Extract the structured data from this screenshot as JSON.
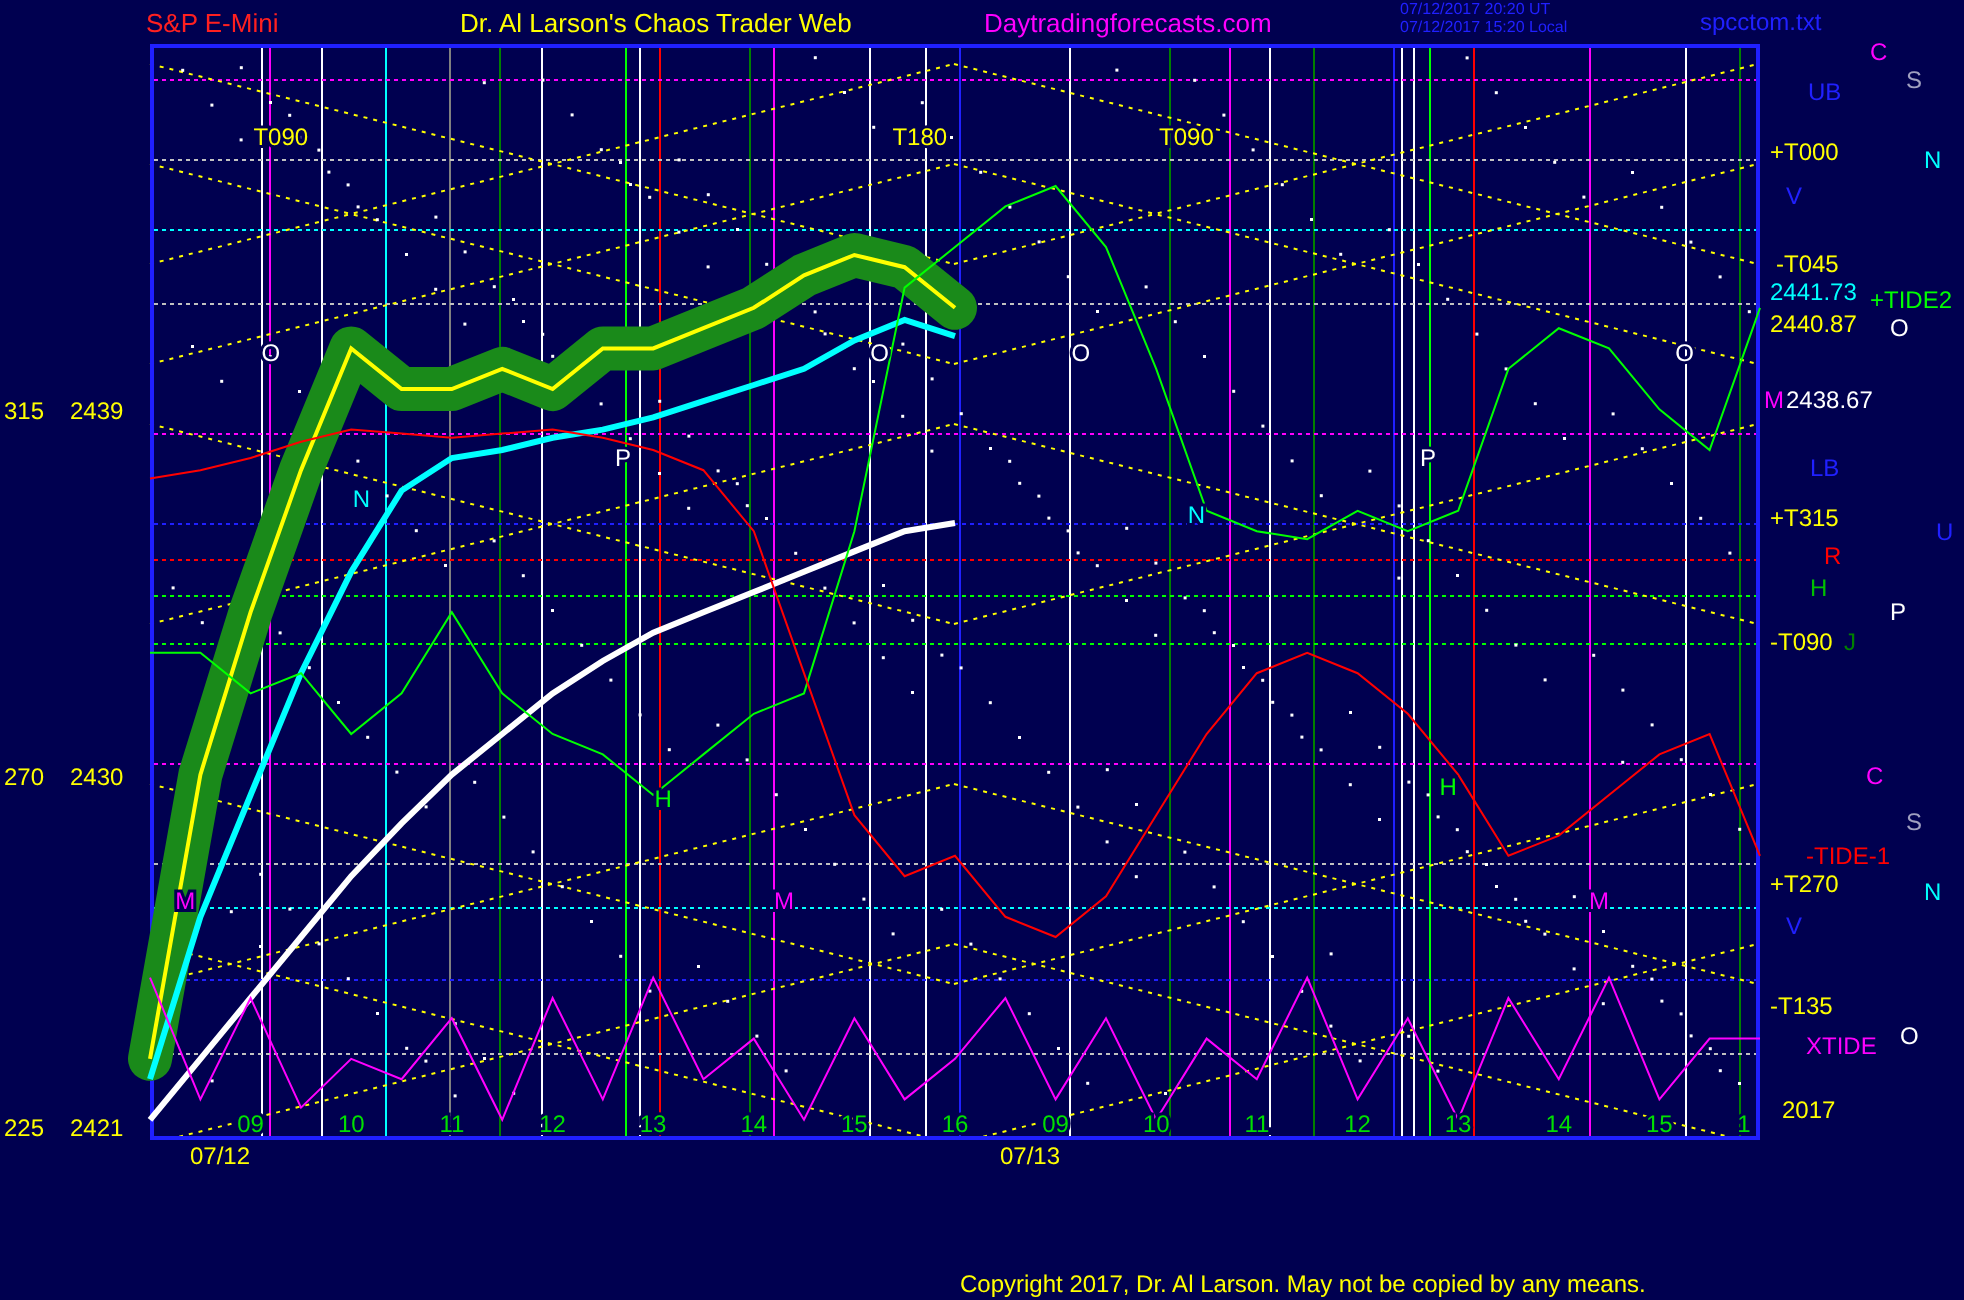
{
  "header": {
    "symbol": "S&P E-Mini",
    "title": "Dr. Al Larson's Chaos Trader Web",
    "site": "Daytradingforecasts.com",
    "timestamps": [
      "07/12/2017 20:20 UT",
      "07/12/2017 15:20 Local"
    ],
    "file": "spcctom.txt"
  },
  "chart": {
    "chart_data": {
      "type": "line",
      "categories": [
        null,
        null,
        "09",
        null,
        "10",
        null,
        "11",
        null,
        "12",
        null,
        "13",
        null,
        "14",
        null,
        "15",
        null,
        "16",
        null,
        "09",
        null,
        "10",
        null,
        "11",
        null,
        "12",
        null,
        "13",
        null,
        "14",
        null,
        "15",
        null,
        "1"
      ],
      "ylim": [
        2421,
        2448
      ],
      "grid": true,
      "yticks": [
        2439,
        2430,
        2421
      ],
      "series": [
        {
          "color": "#ffff00",
          "values": [
            2423,
            2430,
            2434,
            2437.5,
            2440.5,
            2439.5,
            2439.5,
            2440,
            2439.5,
            2440.5,
            2440.5,
            2441,
            2441.5,
            2442.3,
            2442.8,
            2442.5,
            2441.5,
            null,
            null,
            null,
            null,
            null,
            null,
            null,
            null,
            null,
            null,
            null,
            null,
            null,
            null,
            null,
            null
          ]
        },
        {
          "color": "#ffffff",
          "values": [
            2421.5,
            2423,
            2424.5,
            2426,
            2427.5,
            2428.8,
            2430,
            2431,
            2432,
            2432.8,
            2433.5,
            2434,
            2434.5,
            2435,
            2435.5,
            2436,
            2436.2,
            null,
            null,
            null,
            null,
            null,
            null,
            null,
            null,
            null,
            null,
            null,
            null,
            null,
            null,
            null,
            null
          ]
        },
        {
          "color": "#00ffff",
          "values": [
            2422.5,
            2426.5,
            2429.5,
            2432.5,
            2435,
            2437,
            2437.8,
            2438,
            2438.3,
            2438.5,
            2438.8,
            2439.2,
            2439.6,
            2440,
            2440.7,
            2441.2,
            2440.8,
            null,
            null,
            null,
            null,
            null,
            null,
            null,
            null,
            null,
            null,
            null,
            null,
            null,
            null,
            null,
            null
          ]
        },
        {
          "color": "#00ff00",
          "values": [
            2433,
            2433,
            2432,
            2432.5,
            2431,
            2432,
            2434,
            2432,
            2431,
            2430.5,
            2429.5,
            2430.5,
            2431.5,
            2432,
            2436,
            2442,
            2443,
            2444,
            2444.5,
            2443,
            2440,
            2436.5,
            2436,
            2435.8,
            2436.5,
            2436,
            2436.5,
            2440,
            2441,
            2440.5,
            2439,
            2438,
            2441.5
          ]
        },
        {
          "color": "#ff0000",
          "values": [
            2437.3,
            2437.5,
            2437.8,
            2438.2,
            2438.5,
            2438.4,
            2438.3,
            2438.4,
            2438.5,
            2438.3,
            2438,
            2437.5,
            2436,
            2432.5,
            2429,
            2427.5,
            2428,
            2426.5,
            2426,
            2427,
            2429,
            2431,
            2432.5,
            2433,
            2432.5,
            2431.5,
            2430,
            2428,
            2428.5,
            2429.5,
            2430.5,
            2431,
            2428
          ]
        },
        {
          "color": "#ff00ff",
          "values": [
            2425,
            2422,
            2424.5,
            2421.8,
            2423,
            2422.5,
            2424,
            2421.5,
            2424.5,
            2422,
            2425,
            2422.5,
            2423.5,
            2421.5,
            2424,
            2422,
            2423,
            2424.5,
            2422,
            2424,
            2421.5,
            2423.5,
            2422.5,
            2425,
            2422,
            2424,
            2421.5,
            2424.5,
            2422.5,
            2425,
            2422,
            2423.5,
            2423.5
          ]
        }
      ]
    },
    "plot_labels": [
      {
        "text": "T090",
        "color": "#ffff00"
      },
      {
        "text": "T180",
        "color": "#ffff00"
      },
      {
        "text": "T090",
        "color": "#ffff00"
      },
      {
        "text": "O",
        "color": "#ffffff"
      },
      {
        "text": "O",
        "color": "#ffffff"
      },
      {
        "text": "O",
        "color": "#ffffff"
      },
      {
        "text": "O",
        "color": "#ffffff"
      },
      {
        "text": "N",
        "color": "#00ffff"
      },
      {
        "text": "N",
        "color": "#00ffff"
      },
      {
        "text": "P",
        "color": "#ffffff"
      },
      {
        "text": "P",
        "color": "#ffffff"
      },
      {
        "text": "H",
        "color": "#00ff00"
      },
      {
        "text": "H",
        "color": "#00ff00"
      },
      {
        "text": "M",
        "color": "#ff00ff"
      },
      {
        "text": "M",
        "color": "#ff00ff"
      },
      {
        "text": "M",
        "color": "#ff00ff"
      }
    ],
    "angle_labels": [
      "315",
      "270",
      "225"
    ]
  },
  "right_labels": [
    {
      "text": "C",
      "color": "#ff00ff"
    },
    {
      "text": "S",
      "color": "#a0a0c0"
    },
    {
      "text": "UB",
      "color": "#2020ff"
    },
    {
      "text": "+T000",
      "color": "#ffff00"
    },
    {
      "text": "N",
      "color": "#00ffff"
    },
    {
      "text": "V",
      "color": "#2020ff"
    },
    {
      "text": "-T045",
      "color": "#ffff00"
    },
    {
      "text": "2441.73",
      "color": "#00ffff"
    },
    {
      "text": "+TIDE2",
      "color": "#00ff00"
    },
    {
      "text": "2440.87",
      "color": "#ffff00"
    },
    {
      "text": "O",
      "color": "#ffffff"
    },
    {
      "text": "M",
      "color": "#ff00ff"
    },
    {
      "text": "2438.67",
      "color": "#ffffff"
    },
    {
      "text": "LB",
      "color": "#2020ff"
    },
    {
      "text": "+T315",
      "color": "#ffff00"
    },
    {
      "text": "U",
      "color": "#2020ff"
    },
    {
      "text": "R",
      "color": "#ff0000"
    },
    {
      "text": "H",
      "color": "#00c000"
    },
    {
      "text": "P",
      "color": "#ffffff"
    },
    {
      "text": "-T090",
      "color": "#ffff00"
    },
    {
      "text": "J",
      "color": "#008000"
    },
    {
      "text": "C",
      "color": "#ff00ff"
    },
    {
      "text": "S",
      "color": "#a0a0c0"
    },
    {
      "text": "-TIDE-1",
      "color": "#ff0000"
    },
    {
      "text": "+T270",
      "color": "#ffff00"
    },
    {
      "text": "N",
      "color": "#00ffff"
    },
    {
      "text": "V",
      "color": "#2020ff"
    },
    {
      "text": "-T135",
      "color": "#ffff00"
    },
    {
      "text": "XTIDE",
      "color": "#ff00ff"
    },
    {
      "text": "O",
      "color": "#ffffff"
    },
    {
      "text": "2017",
      "color": "#ffff00"
    }
  ],
  "dates": [
    "07/12",
    "07/13"
  ],
  "copyright": "Copyright 2017, Dr. Al Larson. May not be copied by any means."
}
